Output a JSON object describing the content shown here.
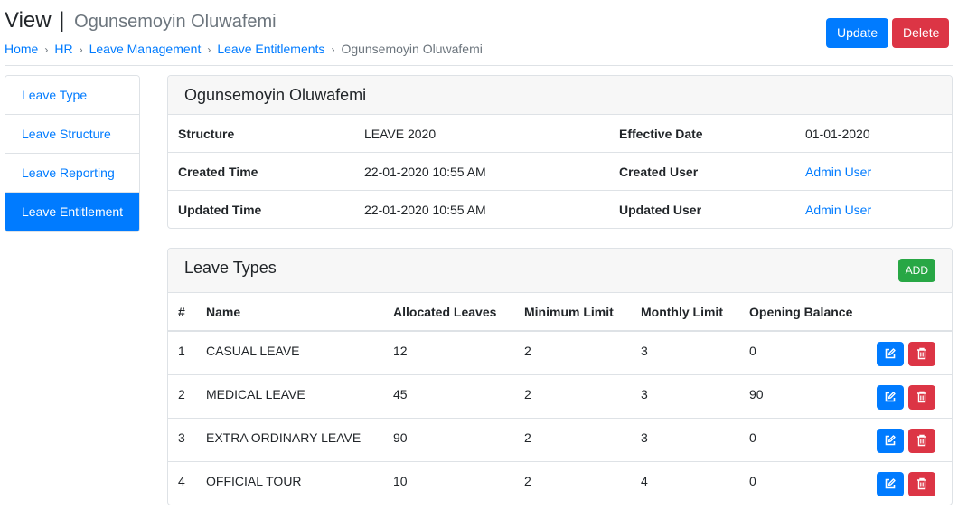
{
  "header": {
    "title": "View",
    "separator": "|",
    "subtitle": "Ogunsemoyin Oluwafemi",
    "breadcrumb": [
      {
        "label": "Home"
      },
      {
        "label": "HR"
      },
      {
        "label": "Leave Management"
      },
      {
        "label": "Leave Entitlements"
      }
    ],
    "breadcrumb_current": "Ogunsemoyin Oluwafemi",
    "breadcrumb_separator": "›",
    "update_label": "Update",
    "delete_label": "Delete"
  },
  "sidebar": {
    "items": [
      {
        "label": "Leave Type",
        "active": false
      },
      {
        "label": "Leave Structure",
        "active": false
      },
      {
        "label": "Leave Reporting",
        "active": false
      },
      {
        "label": "Leave Entitlement",
        "active": true
      }
    ]
  },
  "details": {
    "title": "Ogunsemoyin Oluwafemi",
    "rows": [
      {
        "label1": "Structure",
        "value1": "LEAVE 2020",
        "label2": "Effective Date",
        "value2": "01-01-2020"
      },
      {
        "label1": "Created Time",
        "value1": "22-01-2020 10:55 AM",
        "label2": "Created User",
        "value2": "Admin User"
      },
      {
        "label1": "Updated Time",
        "value1": "22-01-2020 10:55 AM",
        "label2": "Updated User",
        "value2": "Admin User"
      }
    ]
  },
  "leave_types": {
    "title": "Leave Types",
    "add_label": "ADD",
    "columns": [
      "#",
      "Name",
      "Allocated Leaves",
      "Minimum Limit",
      "Monthly Limit",
      "Opening Balance"
    ],
    "rows": [
      {
        "num": "1",
        "name": "CASUAL LEAVE",
        "allocated": "12",
        "minimum": "2",
        "monthly": "3",
        "opening": "0"
      },
      {
        "num": "2",
        "name": "MEDICAL LEAVE",
        "allocated": "45",
        "minimum": "2",
        "monthly": "3",
        "opening": "90"
      },
      {
        "num": "3",
        "name": "EXTRA ORDINARY LEAVE",
        "allocated": "90",
        "minimum": "2",
        "monthly": "3",
        "opening": "0"
      },
      {
        "num": "4",
        "name": "OFFICIAL TOUR",
        "allocated": "10",
        "minimum": "2",
        "monthly": "4",
        "opening": "0"
      }
    ],
    "row_actions": [
      "edit-icon",
      "trash-icon"
    ]
  },
  "colors": {
    "primary": "#007bff",
    "danger": "#dc3545",
    "success": "#28a745",
    "muted": "#6c757d"
  }
}
